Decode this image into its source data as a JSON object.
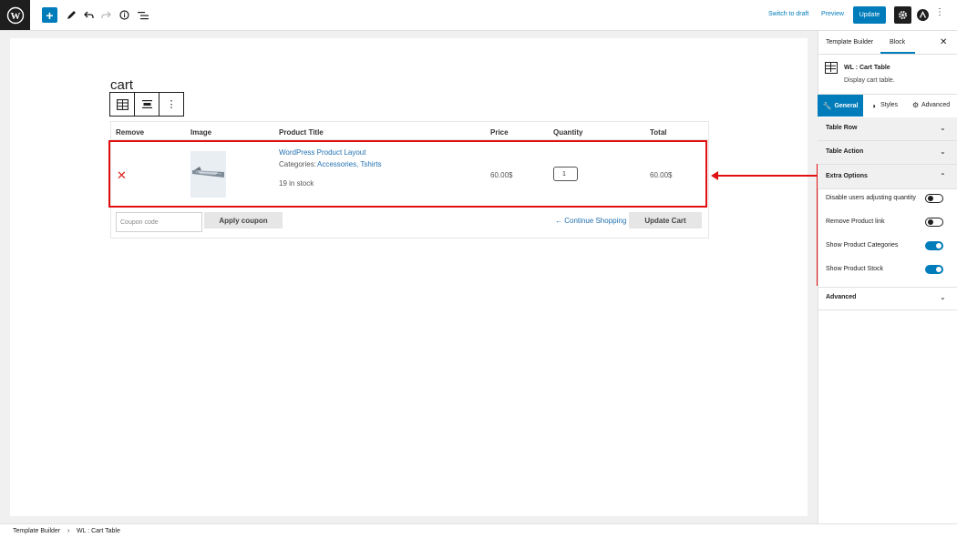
{
  "topbar": {
    "switch_to_draft": "Switch to draft",
    "preview": "Preview",
    "update": "Update",
    "icons": [
      "wordpress-logo",
      "plus-icon",
      "pen-icon",
      "undo-icon",
      "redo-icon",
      "info-icon",
      "list-view-icon",
      "gear-icon",
      "astra-icon",
      "more-vertical-icon"
    ]
  },
  "editor": {
    "page_title": "cart",
    "table": {
      "headers": {
        "remove": "Remove",
        "image": "Image",
        "title": "Product Title",
        "price": "Price",
        "quantity": "Quantity",
        "total": "Total"
      },
      "row": {
        "product_name": "WordPress Product Layout",
        "categories_label": "Categories:",
        "categories": "Accessories, Tshirts",
        "stock": "19 in stock",
        "price": "60.00$",
        "quantity": "1",
        "total": "60.00$"
      }
    },
    "coupon_placeholder": "Coupon code",
    "apply_coupon": "Apply coupon",
    "continue_shopping": "← Continue Shopping",
    "update_cart": "Update Cart"
  },
  "sidebar": {
    "tabs": [
      "Template Builder",
      "Block"
    ],
    "active_tab": "Block",
    "block_name": "WL : Cart Table",
    "block_desc": "Display cart table.",
    "style_tabs": [
      "General",
      "Styles",
      "Advanced"
    ],
    "panels": {
      "table_row": "Table Row",
      "table_action": "Table Action",
      "extra_options": "Extra Options",
      "advanced": "Advanced"
    },
    "options": [
      {
        "label": "Disable users adjusting quantity",
        "on": false
      },
      {
        "label": "Remove Product link",
        "on": false
      },
      {
        "label": "Show Product Categories",
        "on": true
      },
      {
        "label": "Show Product Stock",
        "on": true
      }
    ]
  },
  "breadcrumb": {
    "root": "Template Builder",
    "separator": "›",
    "current": "WL : Cart Table"
  },
  "colors": {
    "accent": "#007cba",
    "highlight": "#e01010",
    "remove": "#e02020"
  }
}
